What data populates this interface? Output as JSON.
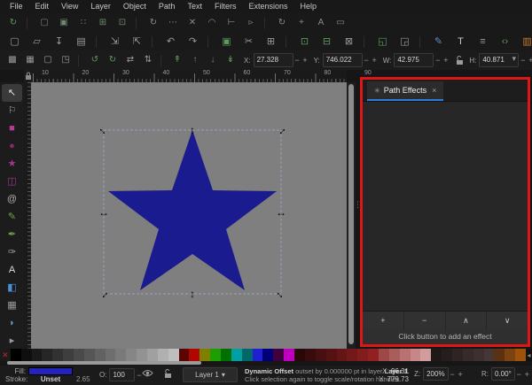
{
  "menu": {
    "items": [
      "File",
      "Edit",
      "View",
      "Layer",
      "Object",
      "Path",
      "Text",
      "Filters",
      "Extensions",
      "Help"
    ]
  },
  "snap_bar": {
    "items": [
      {
        "name": "snap-enable-icon",
        "glyph": "↻",
        "color": "#5d9b5d"
      },
      {
        "name": "sep"
      },
      {
        "name": "snap-bbox-icon",
        "glyph": "▢",
        "color": "#6f8a6f"
      },
      {
        "name": "snap-bbox-edges-icon",
        "glyph": "▣",
        "color": "#6f8a6f"
      },
      {
        "name": "snap-bbox-corners-icon",
        "glyph": "∷",
        "color": "#6f8a6f"
      },
      {
        "name": "snap-bbox-midpoints-icon",
        "glyph": "⊞",
        "color": "#6f8a6f"
      },
      {
        "name": "snap-bbox-centers-icon",
        "glyph": "⊡",
        "color": "#6f8a6f"
      },
      {
        "name": "sep"
      },
      {
        "name": "snap-nodes-icon",
        "glyph": "↻",
        "color": "#8a8a8a"
      },
      {
        "name": "snap-intersections-icon",
        "glyph": "⋯",
        "color": "#8a8a8a"
      },
      {
        "name": "snap-cusp-nodes-icon",
        "glyph": "✕",
        "color": "#8a8a8a"
      },
      {
        "name": "snap-smooth-nodes-icon",
        "glyph": "◠",
        "color": "#8a8a8a"
      },
      {
        "name": "snap-midpoints-icon",
        "glyph": "⊢",
        "color": "#8a8a8a"
      },
      {
        "name": "snap-others-icon",
        "glyph": "▹",
        "color": "#8a8a8a"
      },
      {
        "name": "sep"
      },
      {
        "name": "snap-object-centers-icon",
        "glyph": "↻",
        "color": "#8a8a8a"
      },
      {
        "name": "snap-rotation-center-icon",
        "glyph": "+",
        "color": "#8a8a8a"
      },
      {
        "name": "snap-text-baseline-icon",
        "glyph": "A",
        "color": "#8a8a8a"
      },
      {
        "name": "snap-page-border-icon",
        "glyph": "▭",
        "color": "#8a8a8a"
      }
    ]
  },
  "command_bar": {
    "items": [
      {
        "name": "new-document-icon",
        "glyph": "▢",
        "color": "#9a9a9a"
      },
      {
        "name": "open-icon",
        "glyph": "▱",
        "color": "#9a9a9a"
      },
      {
        "name": "save-icon",
        "glyph": "↧",
        "color": "#9a9a9a"
      },
      {
        "name": "print-icon",
        "glyph": "▤",
        "color": "#9a9a9a"
      },
      {
        "name": "sep"
      },
      {
        "name": "import-icon",
        "glyph": "⇲",
        "color": "#9a9a9a"
      },
      {
        "name": "export-icon",
        "glyph": "⇱",
        "color": "#9a9a9a"
      },
      {
        "name": "sep"
      },
      {
        "name": "undo-icon",
        "glyph": "↶",
        "color": "#9a9a9a"
      },
      {
        "name": "redo-icon",
        "glyph": "↷",
        "color": "#9a9a9a"
      },
      {
        "name": "sep"
      },
      {
        "name": "copy-icon",
        "glyph": "▣",
        "color": "#5d9b5d"
      },
      {
        "name": "cut-icon",
        "glyph": "✂",
        "color": "#9a9a9a"
      },
      {
        "name": "paste-icon",
        "glyph": "⊞",
        "color": "#9a9a9a"
      },
      {
        "name": "sep"
      },
      {
        "name": "duplicate-icon",
        "glyph": "⊡",
        "color": "#5d9b5d"
      },
      {
        "name": "clone-icon",
        "glyph": "⊟",
        "color": "#5d9b5d"
      },
      {
        "name": "unlink-clone-icon",
        "glyph": "⊠",
        "color": "#9a9a9a"
      },
      {
        "name": "sep"
      },
      {
        "name": "group-icon",
        "glyph": "◱",
        "color": "#5d9b5d"
      },
      {
        "name": "ungroup-icon",
        "glyph": "◲",
        "color": "#9a9a9a"
      },
      {
        "name": "sep"
      },
      {
        "name": "fill-stroke-icon",
        "glyph": "✎",
        "color": "#5a8fd0"
      },
      {
        "name": "text-dialog-icon",
        "glyph": "T",
        "color": "#c8c8c8"
      },
      {
        "name": "align-dialog-icon",
        "glyph": "≡",
        "color": "#9a9a9a"
      },
      {
        "name": "xml-editor-icon",
        "glyph": "‹›",
        "color": "#5d9b5d"
      },
      {
        "name": "document-properties-icon",
        "glyph": "▥",
        "color": "#c87a32"
      },
      {
        "name": "layers-dialog-icon",
        "glyph": "≣",
        "color": "#9a9a9a"
      },
      {
        "name": "sep"
      },
      {
        "name": "preferences-icon",
        "glyph": "⚒",
        "color": "#9a9a9a"
      }
    ]
  },
  "tool_controls": {
    "icons": [
      {
        "name": "select-all-icon",
        "glyph": "▩",
        "color": "#9a9a9a"
      },
      {
        "name": "select-all-layers-icon",
        "glyph": "▦",
        "color": "#9a9a9a"
      },
      {
        "name": "deselect-icon",
        "glyph": "▢",
        "color": "#9a9a9a"
      },
      {
        "name": "zoom-selection-icon",
        "glyph": "◳",
        "color": "#9a9a9a"
      },
      {
        "name": "sep"
      },
      {
        "name": "rotate-ccw-icon",
        "glyph": "↺",
        "color": "#5d9b5d"
      },
      {
        "name": "rotate-cw-icon",
        "glyph": "↻",
        "color": "#5d9b5d"
      },
      {
        "name": "flip-horizontal-icon",
        "glyph": "⇄",
        "color": "#9a9a9a"
      },
      {
        "name": "flip-vertical-icon",
        "glyph": "⇅",
        "color": "#9a9a9a"
      },
      {
        "name": "sep"
      },
      {
        "name": "raise-to-top-icon",
        "glyph": "↟",
        "color": "#5d9b5d"
      },
      {
        "name": "raise-icon",
        "glyph": "↑",
        "color": "#5d9b5d"
      },
      {
        "name": "lower-icon",
        "glyph": "↓",
        "color": "#5d9b5d"
      },
      {
        "name": "lower-to-bottom-icon",
        "glyph": "↡",
        "color": "#5d9b5d"
      }
    ],
    "fields": [
      {
        "name": "x-field",
        "label": "X:",
        "value": "27.328"
      },
      {
        "name": "y-field",
        "label": "Y:",
        "value": "746.022"
      },
      {
        "name": "w-field",
        "label": "W:",
        "value": "42.975"
      },
      {
        "name": "lock"
      },
      {
        "name": "h-field",
        "label": "H:",
        "value": "40.871"
      }
    ],
    "caret": "▾"
  },
  "ruler": {
    "h_labels": [
      "10",
      "20",
      "30",
      "40",
      "50",
      "60",
      "70",
      "80",
      "90"
    ]
  },
  "toolbox": {
    "tools": [
      {
        "name": "selector-tool",
        "glyph": "↖",
        "color": "#e0e0e0",
        "active": true
      },
      {
        "name": "node-tool",
        "glyph": "⚐",
        "color": "#a8a8a8"
      },
      {
        "name": "rectangle-tool",
        "glyph": "■",
        "color": "#b5399b"
      },
      {
        "name": "ellipse-tool",
        "glyph": "●",
        "color": "#8f2570"
      },
      {
        "name": "star-tool",
        "glyph": "★",
        "color": "#a83391"
      },
      {
        "name": "box3d-tool",
        "glyph": "◫",
        "color": "#a83391"
      },
      {
        "name": "spiral-tool",
        "glyph": "@",
        "color": "#b0b0b0"
      },
      {
        "name": "pencil-tool",
        "glyph": "✎",
        "color": "#6aa84f"
      },
      {
        "name": "pen-tool",
        "glyph": "✒",
        "color": "#6aa84f"
      },
      {
        "name": "calligraphy-tool",
        "glyph": "✑",
        "color": "#a8a8a8"
      },
      {
        "name": "text-tool",
        "glyph": "A",
        "color": "#d8d8d8"
      },
      {
        "name": "gradient-tool",
        "glyph": "◧",
        "color": "#4a90d9"
      },
      {
        "name": "mesh-tool",
        "glyph": "▦",
        "color": "#9a9a9a"
      },
      {
        "name": "dropper-tool",
        "glyph": "◗",
        "color": "#5a9bd4"
      },
      {
        "name": "toolbox-expander",
        "glyph": "▸",
        "color": "#9a9a9a"
      }
    ]
  },
  "canvas": {
    "background": "#7f7f7f",
    "star_color": "#1b1b90",
    "selection_dash_color": "#9aa0b8",
    "handle_h": "↔",
    "handle_v": "↕"
  },
  "panel": {
    "tab_icon": "✳",
    "tab_label": "Path Effects",
    "close": "×",
    "underline_color": "#2f7bd9",
    "highlight_color": "#df1616",
    "buttons": [
      {
        "name": "add-effect-button",
        "glyph": "+"
      },
      {
        "name": "remove-effect-button",
        "glyph": "−"
      },
      {
        "name": "move-effect-up-button",
        "glyph": "∧"
      },
      {
        "name": "move-effect-down-button",
        "glyph": "∨"
      }
    ],
    "hint": "Click button to add an effect"
  },
  "palette": {
    "none_glyph": "✕",
    "arrow": "◂",
    "colors": [
      "#000000",
      "#0f0f0f",
      "#1a1a1a",
      "#262626",
      "#323232",
      "#3e3e3e",
      "#4a4a4a",
      "#565656",
      "#626262",
      "#6e6e6e",
      "#7a7a7a",
      "#868686",
      "#929292",
      "#a0a0a0",
      "#b0b0b0",
      "#bebebe",
      "#5c0500",
      "#b00500",
      "#808000",
      "#1e9e00",
      "#007000",
      "#00a0a0",
      "#006868",
      "#2020d0",
      "#000078",
      "#400040",
      "#c000c0",
      "#2a0808",
      "#380c0c",
      "#470f0f",
      "#551212",
      "#641616",
      "#731919",
      "#821d1d",
      "#912020",
      "#9e4848",
      "#ab5d5d",
      "#b87272",
      "#c58787",
      "#d29c9c",
      "#1e1818",
      "#261e1e",
      "#2e2424",
      "#362a2a",
      "#3e3030",
      "#463636",
      "#5a3212",
      "#7c420f",
      "#9e520c"
    ]
  },
  "status_bar": {
    "fill_label": "Fill:",
    "fill_color": "#2424bb",
    "stroke_label": "Stroke:",
    "stroke_value": "Unset",
    "stroke_width": "2.65",
    "opacity_label": "O:",
    "opacity_value": "100",
    "minus": "−",
    "plus": "+",
    "layer_label": "Layer 1",
    "layer_caret": "▾",
    "message_segments": [
      {
        "text": "Dynamic Offset",
        "bold": true
      },
      {
        "text": " outset by 0.000000 pt in layer ",
        "bold": false
      },
      {
        "text": "Layer 1",
        "bold": true
      },
      {
        "text": ". Click selection again to toggle scale/rotation handles.",
        "bold": false
      }
    ],
    "x_label": "X:",
    "x_value": "96.31",
    "y_label": "Y:",
    "y_value": "779.73",
    "zoom_label": "Z:",
    "zoom_value": "200%",
    "rotation_label": "R:",
    "rotation_value": "0.00°"
  }
}
